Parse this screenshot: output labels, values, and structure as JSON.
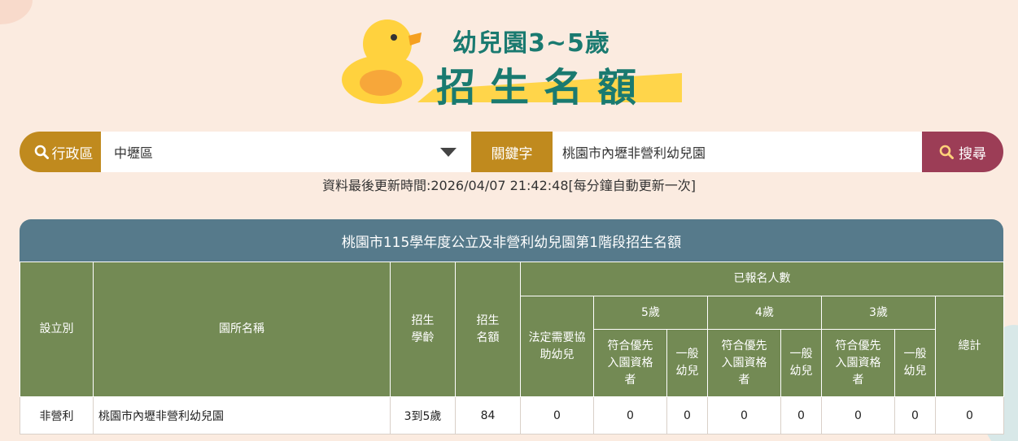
{
  "header": {
    "title_line1": "幼兒園3~5歲",
    "title_line2": "招生名額"
  },
  "search": {
    "district_label": "行政區",
    "district_value": "中壢區",
    "keyword_label": "關鍵字",
    "keyword_value": "桃園市內壢非營利幼兒園",
    "button_label": "搜尋",
    "icons": {
      "district": "search-icon",
      "button": "search-icon",
      "select": "chevron-down-icon"
    }
  },
  "update_text": "資料最後更新時間:2026/04/07 21:42:48[每分鐘自動更新一次]",
  "table": {
    "title": "桃園市115學年度公立及非營利幼兒園第1階段招生名額",
    "headers": {
      "type": "設立別",
      "name": "園所名稱",
      "age": "招生學齡",
      "quota": "招生名額",
      "registered": "已報名人數",
      "legal": "法定需要協助幼兒",
      "age5": "5歲",
      "age4": "4歲",
      "age3": "3歲",
      "priority": "符合優先入園資格者",
      "general": "一般幼兒",
      "total": "總計"
    },
    "rows": [
      {
        "type": "非營利",
        "name": "桃園市內壢非營利幼兒園",
        "age": "3到5歲",
        "quota": "84",
        "legal": "0",
        "age5_priority": "0",
        "age5_general": "0",
        "age4_priority": "0",
        "age4_general": "0",
        "age3_priority": "0",
        "age3_general": "0",
        "total": "0"
      }
    ]
  },
  "colors": {
    "background": "#fbebe0",
    "label_gold": "#c08a1e",
    "button_maroon": "#9c3d56",
    "table_title": "#567a8b",
    "header_green": "#738a54",
    "logo_teal": "#1a7a70",
    "duck_yellow": "#ffd54a"
  }
}
